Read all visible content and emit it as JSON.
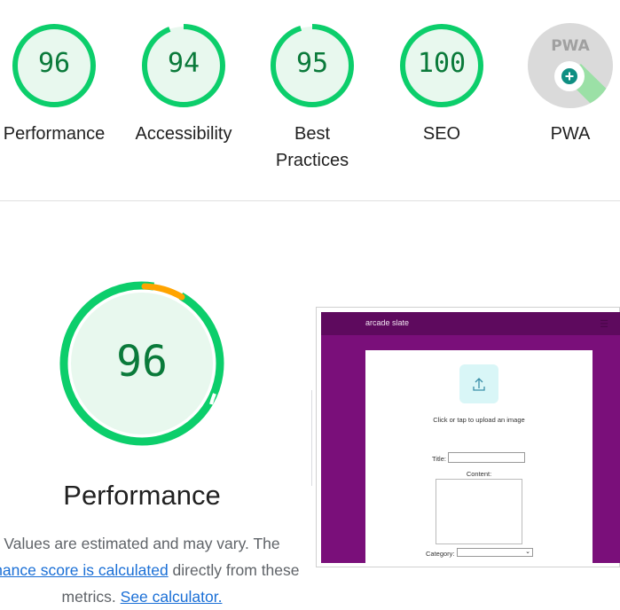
{
  "categories": [
    {
      "key": "performance",
      "score": "96",
      "label": "Performance",
      "score_value": 96
    },
    {
      "key": "accessibility",
      "score": "94",
      "label": "Accessibility",
      "score_value": 94
    },
    {
      "key": "best-practices",
      "score": "95",
      "label_line1": "Best",
      "label_line2": "Practices",
      "score_value": 95
    },
    {
      "key": "seo",
      "score": "100",
      "label": "SEO",
      "score_value": 100
    },
    {
      "key": "pwa",
      "badge": "PWA",
      "label": "PWA"
    }
  ],
  "performance_section": {
    "score": "96",
    "title": "Performance",
    "desc_line1": "Values are estimated and may vary. The",
    "desc_link1": "rmance score is calculated",
    "desc_line2_rest": " directly from these",
    "desc_line3_prefix": "metrics. ",
    "desc_link2": "See calculator."
  },
  "screenshot": {
    "brand": "arcade slate",
    "menu_icon": "hamburger-icon",
    "upload_icon": "upload-icon",
    "upload_text": "Click or tap to upload an image",
    "title_label": "Title:",
    "content_label": "Content:",
    "category_label": "Category:",
    "category_arrow": "⌄"
  },
  "colors": {
    "pass_green": "#0cce6b",
    "pass_fill": "#e8f8ee",
    "score_text": "#0a7a3a",
    "warn_orange": "#ffa400",
    "link_blue": "#1a6fd6",
    "pwa_gray": "#dadada",
    "site_purple": "#7a0f7a"
  }
}
